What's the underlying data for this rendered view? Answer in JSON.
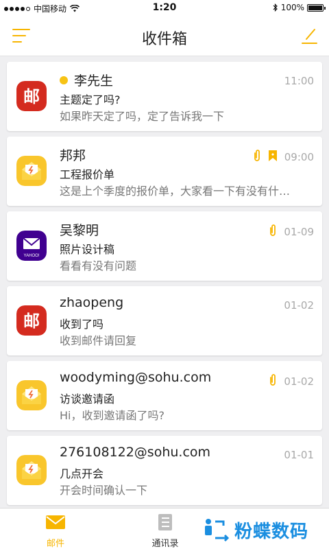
{
  "status_bar": {
    "carrier": "中国移动",
    "time": "1:20",
    "battery_percent": "100%",
    "signal_bars_filled": 4,
    "signal_bars_total": 5,
    "battery_level": 1.0
  },
  "header": {
    "title": "收件箱",
    "left_icon": "menu-icon",
    "right_icon": "compose-icon",
    "accent_color": "#f7b500"
  },
  "emails": [
    {
      "sender": "李先生",
      "subject": "主题定了吗?",
      "preview": "如果昨天定了吗，定了告诉我一下",
      "date": "11:00",
      "unread": true,
      "attachment": false,
      "flagged": false,
      "avatar": "china-post-icon"
    },
    {
      "sender": "邦邦",
      "subject": "工程报价单",
      "preview": "这是上个季度的报价单，大家看一下有没有什么问题",
      "date": "09:00",
      "unread": false,
      "attachment": true,
      "flagged": true,
      "avatar": "envelope-icon"
    },
    {
      "sender": "吴黎明",
      "subject": "照片设计稿",
      "preview": "看看有没有问题",
      "date": "01-09",
      "unread": false,
      "attachment": true,
      "flagged": false,
      "avatar": "yahoo-mail-icon",
      "avatar_label": "YAHOO!"
    },
    {
      "sender": "zhaopeng",
      "subject": "收到了吗",
      "preview": "收到邮件请回复",
      "date": "01-02",
      "unread": false,
      "attachment": false,
      "flagged": false,
      "avatar": "china-post-icon"
    },
    {
      "sender": "woodyming@sohu.com",
      "subject": "访谈邀请函",
      "preview": "Hi，收到邀请函了吗?",
      "date": "01-02",
      "unread": false,
      "attachment": true,
      "flagged": false,
      "avatar": "envelope-icon"
    },
    {
      "sender": "276108122@sohu.com",
      "subject": "几点开会",
      "preview": "开会时间确认一下",
      "date": "01-01",
      "unread": false,
      "attachment": false,
      "flagged": false,
      "avatar": "envelope-icon"
    }
  ],
  "tabbar": {
    "tabs": [
      {
        "label": "邮件",
        "icon": "mail-icon",
        "active": true
      },
      {
        "label": "通讯录",
        "icon": "contacts-icon",
        "active": false
      }
    ]
  },
  "watermark": {
    "text": "粉蝶数码"
  }
}
